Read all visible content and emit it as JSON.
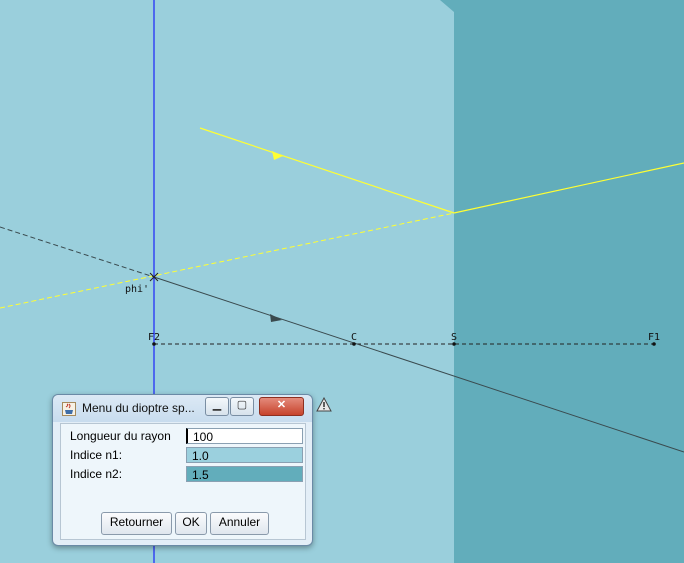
{
  "canvas": {
    "labels": {
      "phi": "phi'",
      "f2": "F2",
      "c": "C",
      "s": "S",
      "f1": "F1"
    },
    "colors": {
      "background_medium1": "#9acfdc",
      "background_medium2": "#62adbb",
      "axis": "#0000ff",
      "incident_ray": "#ffff33",
      "refracted_ray": "#3a4a4e"
    }
  },
  "dialog": {
    "title": "Menu du dioptre sp...",
    "titlebar_icons": [
      "java-cup-icon",
      "minimize-icon",
      "maximize-icon",
      "close-icon"
    ],
    "fields": [
      {
        "label": "Longueur du rayon",
        "value": "100"
      },
      {
        "label": "Indice n1:",
        "value": "1.0"
      },
      {
        "label": "Indice n2:",
        "value": "1.5"
      }
    ],
    "buttons": {
      "back": "Retourner",
      "ok": "OK",
      "cancel": "Annuler"
    }
  },
  "warning_icon": "warning-icon"
}
